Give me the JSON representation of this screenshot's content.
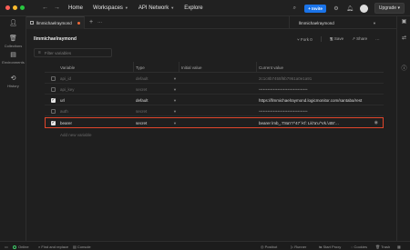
{
  "topbar": {
    "nav_home": "Home",
    "nav_workspaces": "Workspaces",
    "nav_api_network": "API Network",
    "nav_explore": "Explore",
    "invite_label": "Invite",
    "upgrade_label": "Upgrade"
  },
  "sidebar": {
    "items": [
      {
        "label": "",
        "icon": "user-icon"
      },
      {
        "label": "Collections",
        "icon": "collections-icon"
      },
      {
        "label": "Environments",
        "icon": "environments-icon"
      },
      {
        "label": "History",
        "icon": "history-icon"
      }
    ]
  },
  "tabstrip": {
    "tab_label": "llmmichaelraymond",
    "env_select": "llmmichaelraymond"
  },
  "environment": {
    "title": "llmmichaelraymond",
    "fork_label": "Fork",
    "fork_count": "0",
    "save_label": "Save",
    "share_label": "Share",
    "filter_placeholder": "Filter variables"
  },
  "table": {
    "headers": [
      "Variable",
      "Type",
      "Initial value",
      "Current value"
    ],
    "rows": [
      {
        "checked": false,
        "variable": "api_id",
        "type": "default",
        "initial": "",
        "current": "2c1c8b7455f6b7961a0e1a91",
        "disabled": true
      },
      {
        "checked": false,
        "variable": "api_key",
        "type": "secret",
        "initial": "",
        "current": "••••••••••••••••••••••••••••••••••",
        "disabled": true
      },
      {
        "checked": true,
        "variable": "url",
        "type": "default",
        "initial": "",
        "current": "https://llmmichaelraymond.logicmonitor.com/santaba/rest",
        "disabled": false
      },
      {
        "checked": false,
        "variable": "auth",
        "type": "secret",
        "initial": "",
        "current": "••••••••••••••••••••••••••••••••••",
        "disabled": true
      },
      {
        "checked": true,
        "variable": "bearer",
        "type": "secret",
        "initial": "",
        "current": "bearer lmb_.'t'8a'r'r^47`l<f: Lk\\'a'u^Vk.\\4t8'…",
        "disabled": false
      }
    ],
    "add_placeholder": "Add new variable"
  },
  "statusbar": {
    "online": "Online",
    "find_replace": "Find and replace",
    "console": "Console",
    "postbot": "Postbot",
    "runner": "Runner",
    "start_proxy": "Start Proxy",
    "cookies": "Cookies",
    "trash": "Trash"
  },
  "colors": {
    "accent": "#1a73e8",
    "highlight": "#e0452b",
    "dirty_dot": "#f26b3a"
  }
}
